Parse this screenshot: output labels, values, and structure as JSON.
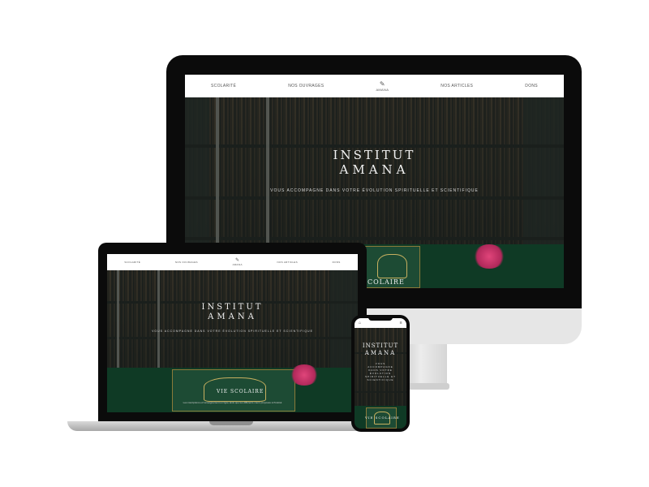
{
  "site": {
    "nav": {
      "item1": "SCOLARITÉ",
      "item2": "NOS OUVRAGES",
      "item3": "NOS ARTICLES",
      "item4": "DONS",
      "logo_text": "AMANA"
    },
    "hero": {
      "title_line1": "INSTITUT",
      "title_line2": "AMANA",
      "subtitle": "VOUS ACCOMPAGNE DANS VOTRE ÉVOLUTION SPIRITUELLE ET SCIENTIFIQUE",
      "phone_subtitle": "VOUS ACCOMPAGNE DANS VOTRE ÉVOLUTION SPIRITUELLE ET SCIENTIFIQUE"
    },
    "section": {
      "title": "VIE SCOLAIRE",
      "desktop_partial_title": "COLAIRE",
      "laptop_title": "VIE SCOLAIRE",
      "description": "Les inscriptions et l'enseignement en ligne ainsi que les différents cours proposés à l'Institut"
    }
  },
  "colors": {
    "device_frame": "#0b0b0b",
    "hero_overlay": "#1d2320",
    "section_green": "#0f3a25",
    "nav_background": "#ffffff"
  }
}
